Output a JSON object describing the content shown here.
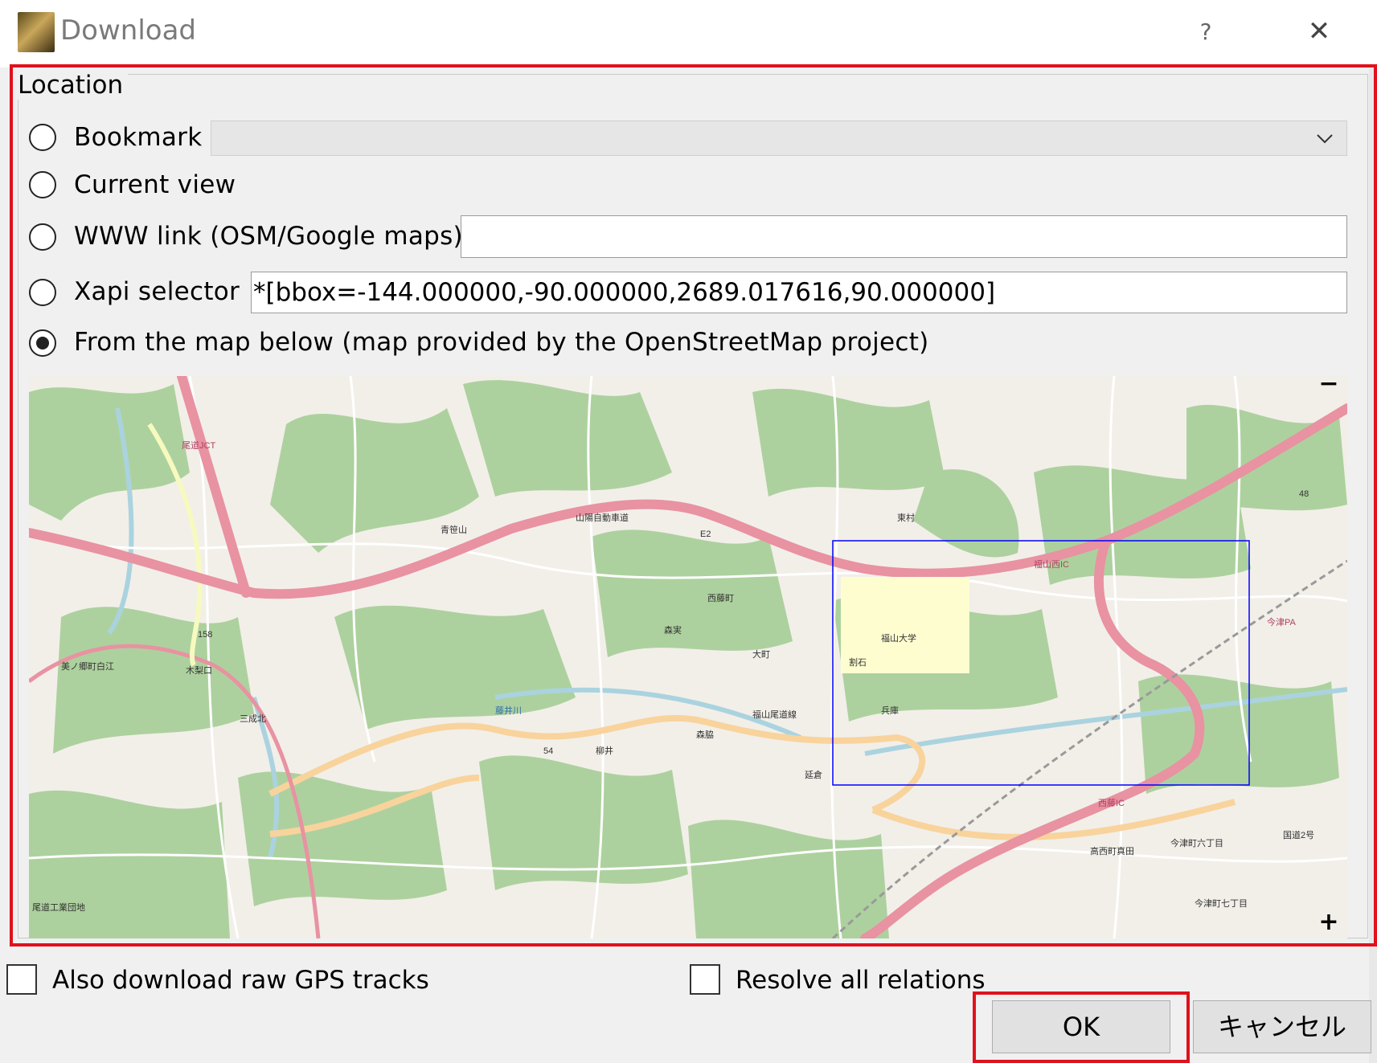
{
  "window": {
    "title": "Download",
    "help_glyph": "?",
    "close_glyph": "✕"
  },
  "location": {
    "legend": "Location",
    "options": {
      "bookmark": "Bookmark",
      "current_view": "Current view",
      "www_link": "WWW link (OSM/Google maps)",
      "xapi": "Xapi selector",
      "from_map": "From the map below (map provided by the OpenStreetMap project)"
    },
    "selected_option": "from_map",
    "bookmark_value": "",
    "www_link_value": "",
    "xapi_value": "*[bbox=-144.000000,-90.000000,2689.017616,90.000000]"
  },
  "map": {
    "zoom_in": "+",
    "zoom_out": "−",
    "labels": {
      "uni": "福山大学",
      "nishifujimachi": "西藤町",
      "fukuyamanishi_ic": "福山西IC",
      "sanyo_expressway": "山陽自動車道",
      "fukuyama_onomichi_line": "福山尾道線",
      "onomichi_jct": "尾道JCT",
      "aohoyama": "青笹山",
      "morozane": "森実",
      "ohmachi": "大町",
      "tojimura": "東村",
      "mikawa": "美ノ郷町白江",
      "kinashi": "木梨口",
      "sanseikita": "三成北",
      "fujii_river": "藤井川",
      "takanishi": "高西町真田",
      "nishifuji_ic": "西藤IC",
      "imazu_pa": "今津PA",
      "matsunaga_ic": "福山西IC",
      "imazu6": "今津町六丁目",
      "matsunaga7": "今津町七丁目",
      "route2": "国道2号",
      "onomichi_kogyo": "尾道工業団地",
      "shimoishi": "割石",
      "hyogo": "兵庫",
      "nobeoka": "延倉",
      "mori": "森脇",
      "yanagii": "柳井",
      "r54": "54",
      "r158": "158",
      "r48": "48",
      "e2": "E2"
    }
  },
  "options": {
    "raw_gps": "Also download raw GPS tracks",
    "resolve_relations": "Resolve all relations"
  },
  "buttons": {
    "ok": "OK",
    "cancel": "キャンセル"
  },
  "colors": {
    "highlight": "#e0121c",
    "motorway": "#e892a2",
    "secondary": "#f9d39c",
    "forest": "#add19e",
    "land": "#f2efe9",
    "selection": "#0000ff"
  }
}
